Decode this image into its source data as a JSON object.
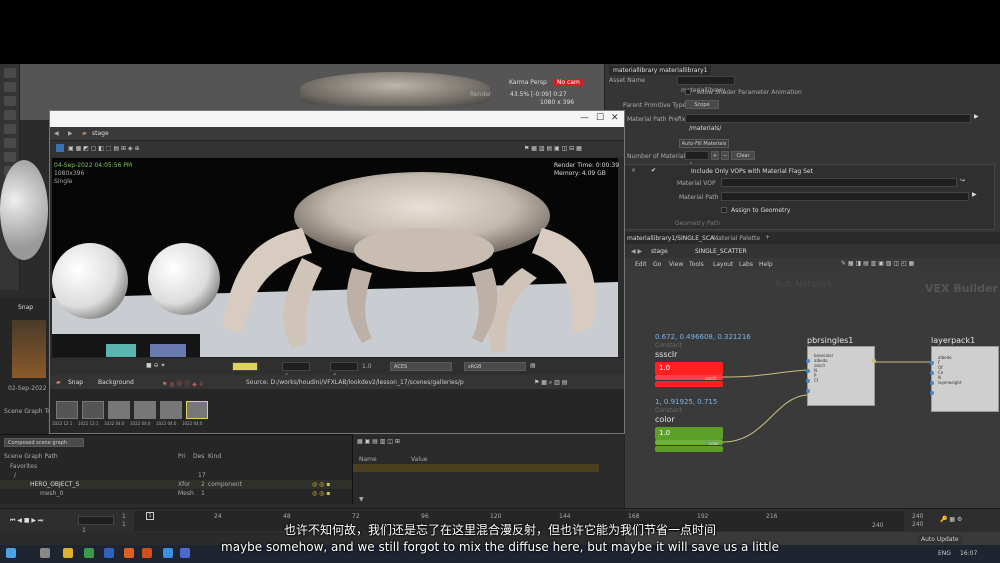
{
  "bg_viewport": {
    "camera": "Karma Persp",
    "cam_btn": "No cam",
    "stats_line1": "43.5%  [-0:09]  0:27",
    "stats_line2": "1080 x 396",
    "render_label": "Render"
  },
  "left_panel": {
    "snap": "Snap",
    "date": "02-Sep-2022 1",
    "scene_graph_tree": "Scene Graph Tree"
  },
  "params": {
    "tab_title": "materiallibrary  materiallibrary1",
    "asset_name_label": "Asset Name",
    "asset_name_value": "materiallibrary",
    "allow_shader_label": "Allow Shader Parameter Animation",
    "parent_primitive_label": "Parent Primitive Type",
    "parent_primitive_value": "Scope",
    "material_path_prefix_label": "Material Path Prefix",
    "material_path_prefix_value": "/materials/",
    "auto_fill_btn": "Auto-Fill Materials",
    "num_materials_label": "Number of Materials",
    "num_materials_value": "1",
    "clear_btn": "Clear",
    "include_only_label": "Include Only VOPs with Material Flag Set",
    "material_vop_label": "Material VOP",
    "material_path_label": "Material Path",
    "assign_geometry_label": "Assign to Geometry",
    "geometry_path_label": "Geometry Path"
  },
  "network": {
    "tab1": "materiallibrary1/SINGLE_SCA...",
    "tab2": "Material Palette",
    "path_stage": "stage",
    "path_node": "SINGLE_SCATTER",
    "menu": [
      "Edit",
      "Go",
      "View",
      "Tools",
      "Layout",
      "Labs",
      "Help"
    ],
    "watermark_left": "Sub Network",
    "watermark_right": "VEX Builder",
    "node_sssclr": {
      "values": "0.672, 0.496608, 0.321216",
      "type": "Constant",
      "name": "sssclr",
      "label": "1.0",
      "out": "sssclr"
    },
    "node_color": {
      "values": "1, 0.91925, 0.715",
      "type": "Constant",
      "name": "color",
      "label": "1.0",
      "out": "color"
    },
    "node_pbr": {
      "name": "pbrsingles1",
      "ports": [
        "basecolor",
        "albedo",
        "sssclr",
        "N",
        "P",
        "Cf",
        "layer"
      ]
    },
    "node_layer": {
      "name": "layerpack1",
      "ports": [
        "albedo",
        "F",
        "Of",
        "Ce",
        "N",
        "layerweight",
        "layer"
      ]
    }
  },
  "stage_window": {
    "title": "stage",
    "min": "—",
    "max": "☐",
    "close": "✕",
    "tab": "stage",
    "date": "04-Sep-2022 04:05:56 PM",
    "res": "1080x396",
    "mode": "Single",
    "render_time": "Render Time: 0:00:39",
    "memory": "Memory: 4.09 GB",
    "bottom_field1": "0",
    "bottom_field2": "1",
    "bottom_field3": "0",
    "bottom_field4": "1.0",
    "aces": "ACES",
    "srgb": "sRGB",
    "snap": "Snap",
    "background": "Background",
    "source": "Source: D:/works/houdini/VFXLAB/lookdev2/lesson_17/scenes/galleries/p",
    "thumbs": [
      "1022 12:1",
      "1022 12:1",
      "1022 04:0",
      "1022 04:0",
      "1022 04:0",
      "1022 04:0"
    ]
  },
  "scene_graph": {
    "mode": "Composed scene graph",
    "col_path": "Scene Graph Path",
    "col_pri": "Pri",
    "col_des": "Des",
    "col_kind": "Kind",
    "favorites": "Favorites",
    "root": "/",
    "root_count": "17",
    "row1_name": "HERO_OBJECT_S",
    "row1_type": "Xfor",
    "row1_count": "2",
    "row1_kind": "component",
    "row2_name": "mesh_0",
    "row2_type": "Mesh",
    "row2_count": "1"
  },
  "properties": {
    "col_name": "Name",
    "col_value": "Value"
  },
  "timeline": {
    "frame": "1",
    "start": "1",
    "start2": "1",
    "ticks": [
      "24",
      "48",
      "72",
      "96",
      "120",
      "144",
      "168",
      "192",
      "216",
      "240"
    ],
    "end": "240",
    "end2": "240"
  },
  "taskbar": {
    "update": "Auto Update",
    "lang": "ENG",
    "time": "16:07"
  },
  "subtitles": {
    "cn": "也许不知何故，我们还是忘了在这里混合漫反射，但也许它能为我们节省一点时间",
    "en": "maybe somehow, and we still forgot to mix the diffuse here, but maybe it will save us a little"
  },
  "colors": {
    "node_red": "#ff2020",
    "node_green": "#5ca02a",
    "wire": "#c9c07a"
  }
}
